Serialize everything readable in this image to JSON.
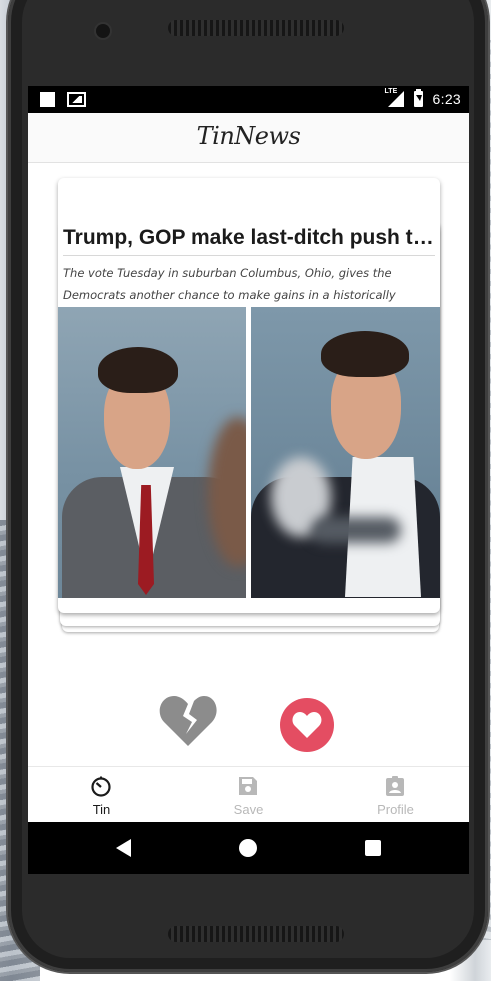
{
  "status_bar": {
    "network": "LTE",
    "time": "6:23",
    "icons": [
      "notification-square-icon",
      "photo-icon",
      "signal-icon",
      "battery-charging-icon"
    ]
  },
  "app": {
    "title": "TinNews"
  },
  "card": {
    "title": "Trump, GOP make last-ditch push to...",
    "description": "The vote Tuesday in suburban Columbus, Ohio, gives the Democrats another chance to make gains in a historically"
  },
  "actions": {
    "dislike_icon": "broken-heart-icon",
    "like_icon": "heart-icon",
    "like_color": "#e44d62",
    "dislike_color": "#8c8c8c"
  },
  "bottom_nav": {
    "items": [
      {
        "label": "Tin",
        "icon": "timer-icon",
        "active": true
      },
      {
        "label": "Save",
        "icon": "save-icon",
        "active": false
      },
      {
        "label": "Profile",
        "icon": "profile-icon",
        "active": false
      }
    ],
    "active_color": "#1b1b1b",
    "inactive_color": "#b8b8b8"
  },
  "system_nav": {
    "icons": [
      "back-icon",
      "home-icon",
      "recents-icon"
    ]
  }
}
